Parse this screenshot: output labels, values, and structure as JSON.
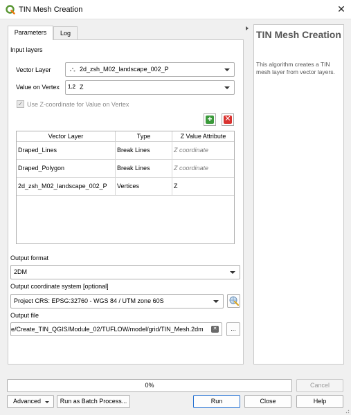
{
  "window": {
    "title": "TIN Mesh Creation",
    "app_icon": "qgis-logo-icon",
    "close_glyph": "✕"
  },
  "tabs": [
    {
      "label": "Parameters",
      "active": true
    },
    {
      "label": "Log",
      "active": false
    }
  ],
  "params": {
    "input_layers_label": "Input layers",
    "vector_layer_label": "Vector Layer",
    "vector_layer_value": "2d_zsh_M02_landscape_002_P",
    "value_on_vertex_label": "Value on Vertex",
    "value_on_vertex_type_badge": "1.2",
    "value_on_vertex_value": "Z",
    "use_z_label": "Use Z-coordinate for Value on Vertex",
    "use_z_checked": true,
    "add_icon": "plus-icon",
    "remove_icon": "remove-icon"
  },
  "table": {
    "columns": [
      "Vector Layer",
      "Type",
      "Z Value Attribute"
    ],
    "rows": [
      {
        "layer": "Draped_Lines",
        "type": "Break Lines",
        "z": "Z coordinate",
        "z_placeholder": true
      },
      {
        "layer": "Draped_Polygon",
        "type": "Break Lines",
        "z": "Z coordinate",
        "z_placeholder": true
      },
      {
        "layer": "2d_zsh_M02_landscape_002_P",
        "type": "Vertices",
        "z": "Z",
        "z_placeholder": false
      }
    ]
  },
  "output": {
    "format_label": "Output format",
    "format_value": "2DM",
    "crs_label": "Output coordinate system [optional]",
    "crs_value": "Project CRS: EPSG:32760 - WGS 84 / UTM zone 60S",
    "crs_icon": "crs-globe-icon",
    "file_label": "Output file",
    "file_value": "e/Create_TIN_QGIS/Module_02/TUFLOW/model/grid/TIN_Mesh.2dm",
    "clear_icon": "clear-input-icon",
    "browse_label": "..."
  },
  "help": {
    "title": "TIN Mesh Creation",
    "text": "This algorithm creates a TIN mesh layer from vector layers."
  },
  "footer": {
    "progress_text": "0%",
    "progress_value": 0,
    "cancel_label": "Cancel",
    "advanced_label": "Advanced",
    "batch_label": "Run as Batch Process...",
    "run_label": "Run",
    "close_label": "Close",
    "help_label": "Help"
  },
  "colors": {
    "accent": "#2a74d2",
    "add_green": "#3a9a3a",
    "remove_red": "#d9322f"
  }
}
